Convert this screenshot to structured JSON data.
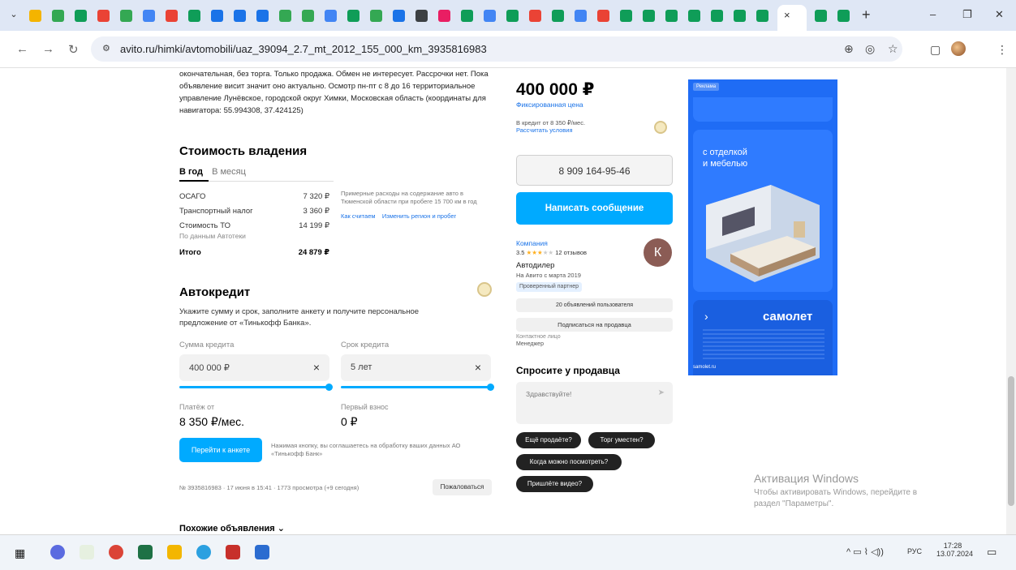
{
  "browser": {
    "active_tab_close": "×",
    "new_tab": "+",
    "tab_dropdown": "⌄",
    "url": "avito.ru/himki/avtomobili/uaz_39094_2.7_mt_2012_155_000_km_3935816983",
    "win_min": "–",
    "win_restore": "❐",
    "win_close": "✕"
  },
  "listing": {
    "description": "окончательная, без торга. Только продажа. Обмен не интересует. Рассрочки нет. Пока объявление висит значит оно актуально. Осмотр пн-пт с 8 до 16 территориальное управление Лунёвское, городской округ Химки, Московская область (координаты для навигатора: 55.994308, 37.424125)",
    "ownership": {
      "title": "Стоимость владения",
      "tab_year": "В год",
      "tab_month": "В месяц",
      "rows": [
        {
          "label": "ОСАГО",
          "value": "7 320 ₽"
        },
        {
          "label": "Транспортный налог",
          "value": "3 360 ₽"
        },
        {
          "label": "Стоимость ТО",
          "value": "14 199 ₽"
        },
        {
          "label": "По данным Автотеки",
          "value": ""
        },
        {
          "label": "Итого",
          "value": "24 879 ₽"
        }
      ],
      "note": "Примерные расходы на содержание авто в Тюменской области при пробеге 15 700 км в год",
      "link_how": "Как считаем",
      "link_change": "Изменить регион и пробег"
    },
    "credit": {
      "title": "Автокредит",
      "text": "Укажите сумму и срок, заполните анкету и получите персональное предложение от «Тинькофф Банка».",
      "sum_label": "Сумма кредита",
      "sum_value": "400 000 ₽",
      "term_label": "Срок кредита",
      "term_value": "5 лет",
      "pay_label": "Платёж от",
      "pay_value": "8 350 ₽/мес.",
      "first_label": "Первый взнос",
      "first_value": "0 ₽",
      "button": "Перейти к анкете",
      "consent": "Нажимая кнопку, вы соглашаетесь на обработку ваших данных АО «Тинькофф Банк»",
      "clear": "×"
    },
    "meta": "№ 3935816983 · 17 июня в 15:41 · 1773 просмотра (+9 сегодня)",
    "report_button": "Пожаловаться",
    "similar": "Похожие объявления"
  },
  "sidebar": {
    "price": "400 000 ₽",
    "price_type": "Фиксированная цена",
    "credit_from": "В кредит от 8 350 ₽/мес.",
    "credit_calc": "Рассчитать условия",
    "phone": "8 909 164-95-46",
    "write_button": "Написать сообщение",
    "seller_type": "Компания",
    "rating": "3.5",
    "reviews": "12 отзывов",
    "seller_name": "Автодилер",
    "since": "На Авито с марта 2019",
    "badge": "Проверенный партнер",
    "ads_count": "20 объявлений пользователя",
    "subscribe": "Подписаться на продавца",
    "contact_label": "Контактное лицо",
    "contact_value": "Менеджер",
    "avatar_letter": "К",
    "ask_title": "Спросите у продавца",
    "ask_placeholder": "Здравствуйте!",
    "chips": [
      "Ещё продаёте?",
      "Торг уместен?",
      "Когда можно посмотреть?",
      "Пришлёте видео?"
    ]
  },
  "ad": {
    "tag": "Реклама",
    "text1": "с отделкой",
    "text2": "и мебелью",
    "brand": "самолет",
    "site": "samolet.ru"
  },
  "windows": {
    "title": "Активация Windows",
    "text1": "Чтобы активировать Windows, перейдите в",
    "text2": "раздел \"Параметры\"."
  },
  "taskbar": {
    "lang": "РУС",
    "time": "17:28",
    "date": "13.07.2024"
  }
}
